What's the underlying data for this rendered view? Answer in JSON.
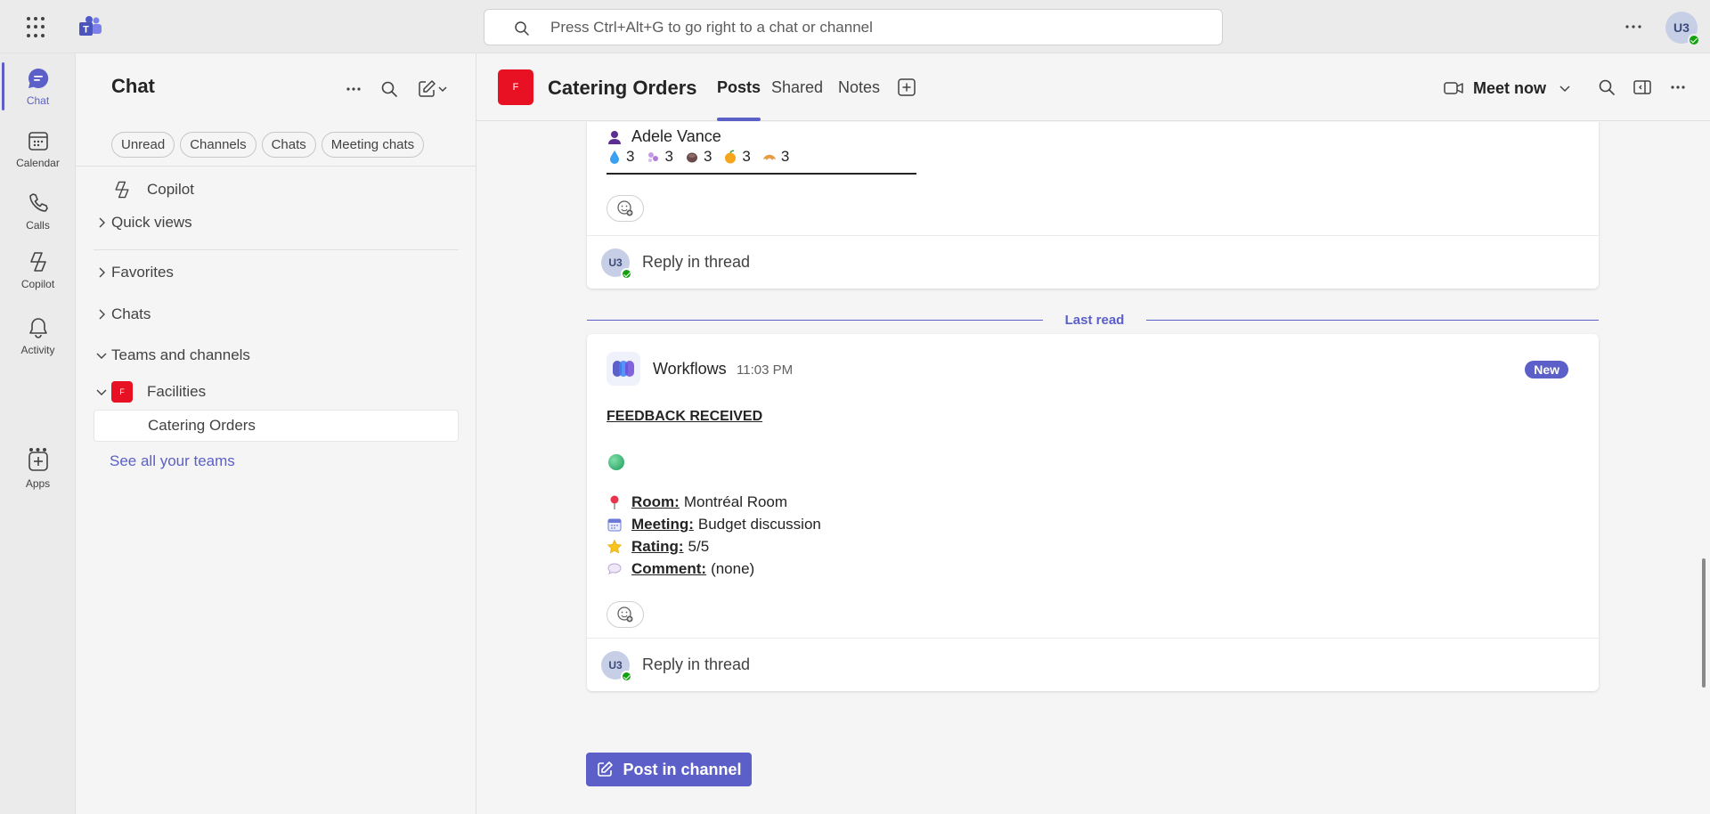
{
  "titlebar": {
    "search_placeholder": "Press Ctrl+Alt+G to go right to a chat or channel",
    "user_initials": "U3"
  },
  "rail": {
    "items": [
      {
        "label": "Chat",
        "icon": "chat-icon",
        "active": true
      },
      {
        "label": "Calendar",
        "icon": "calendar-icon"
      },
      {
        "label": "Calls",
        "icon": "phone-icon"
      },
      {
        "label": "Copilot",
        "icon": "copilot-icon"
      },
      {
        "label": "Activity",
        "icon": "bell-icon"
      },
      {
        "label": "Apps",
        "icon": "apps-plus-icon"
      }
    ]
  },
  "listpane": {
    "title": "Chat",
    "filters": [
      "Unread",
      "Channels",
      "Chats",
      "Meeting chats"
    ],
    "copilot": "Copilot",
    "quick_views": "Quick views",
    "favorites": "Favorites",
    "chats": "Chats",
    "teams_and_channels": "Teams and channels",
    "team_name": "Facilities",
    "team_initial": "F",
    "channel_name": "Catering Orders",
    "see_all": "See all your teams"
  },
  "channel": {
    "initial": "F",
    "name": "Catering Orders",
    "tabs": [
      "Posts",
      "Shared",
      "Notes"
    ],
    "active_tab": "Posts",
    "meet_now": "Meet now"
  },
  "messages": {
    "prev": {
      "author": "Adele Vance",
      "reactions": [
        {
          "icon": "droplet-icon",
          "count": "3"
        },
        {
          "icon": "sparkle-icon",
          "count": "3"
        },
        {
          "icon": "coffee-bean-icon",
          "count": "3"
        },
        {
          "icon": "orange-icon",
          "count": "3"
        },
        {
          "icon": "croissant-icon",
          "count": "3"
        }
      ],
      "reply_label": "Reply in thread",
      "reply_initials": "U3"
    },
    "last_read": "Last read",
    "latest": {
      "sender": "Workflows",
      "time": "11:03 PM",
      "badge": "New",
      "title": "FEEDBACK RECEIVED",
      "fields": [
        {
          "icon": "pin-icon",
          "key": "Room:",
          "value": "Montréal Room"
        },
        {
          "icon": "calendar-icon",
          "key": "Meeting:",
          "value": "Budget discussion"
        },
        {
          "icon": "star-icon",
          "key": "Rating:",
          "value": "5/5"
        },
        {
          "icon": "speech-bubble-icon",
          "key": "Comment:",
          "value": "(none)"
        }
      ],
      "reply_label": "Reply in thread",
      "reply_initials": "U3"
    }
  },
  "post_button": "Post in channel",
  "colors": {
    "brand": "#5b5fc7",
    "team": "#e81123",
    "presence": "#13a10e"
  }
}
